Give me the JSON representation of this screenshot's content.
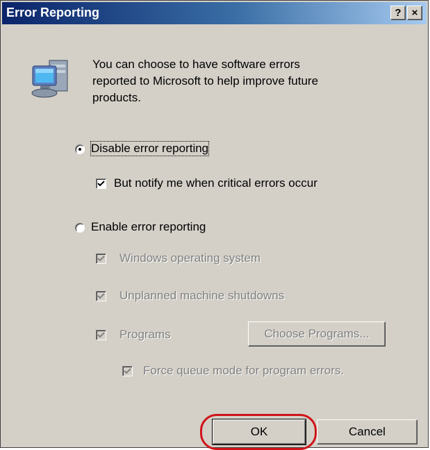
{
  "window": {
    "title": "Error Reporting",
    "help_button": "?",
    "close_button": "×"
  },
  "intro_text": "You can choose to have software errors reported to Microsoft to help improve future products.",
  "intro_lines": [
    "You can choose to have software errors",
    "reported to Microsoft to help improve future",
    "products."
  ],
  "options": {
    "disable": {
      "label": "Disable error reporting",
      "selected": true
    },
    "notify": {
      "label": "But notify me when critical errors occur",
      "checked": true
    },
    "enable": {
      "label": "Enable error reporting",
      "selected": false
    },
    "windows_os": {
      "label": "Windows operating system",
      "checked": true,
      "enabled": false
    },
    "shutdowns": {
      "label": "Unplanned machine shutdowns",
      "checked": true,
      "enabled": false
    },
    "programs": {
      "label": "Programs",
      "checked": true,
      "enabled": false
    },
    "choose_programs": {
      "label": "Choose Programs...",
      "enabled": false
    },
    "force_queue": {
      "label": "Force queue mode for program errors.",
      "checked": true,
      "enabled": false
    }
  },
  "buttons": {
    "ok": "OK",
    "cancel": "Cancel"
  },
  "colors": {
    "titlebar_start": "#0a246a",
    "titlebar_end": "#a6caf0",
    "dialog_bg": "#d4d0c8",
    "highlight": "#d0141a"
  },
  "icons": {
    "computer": "computer-icon"
  }
}
